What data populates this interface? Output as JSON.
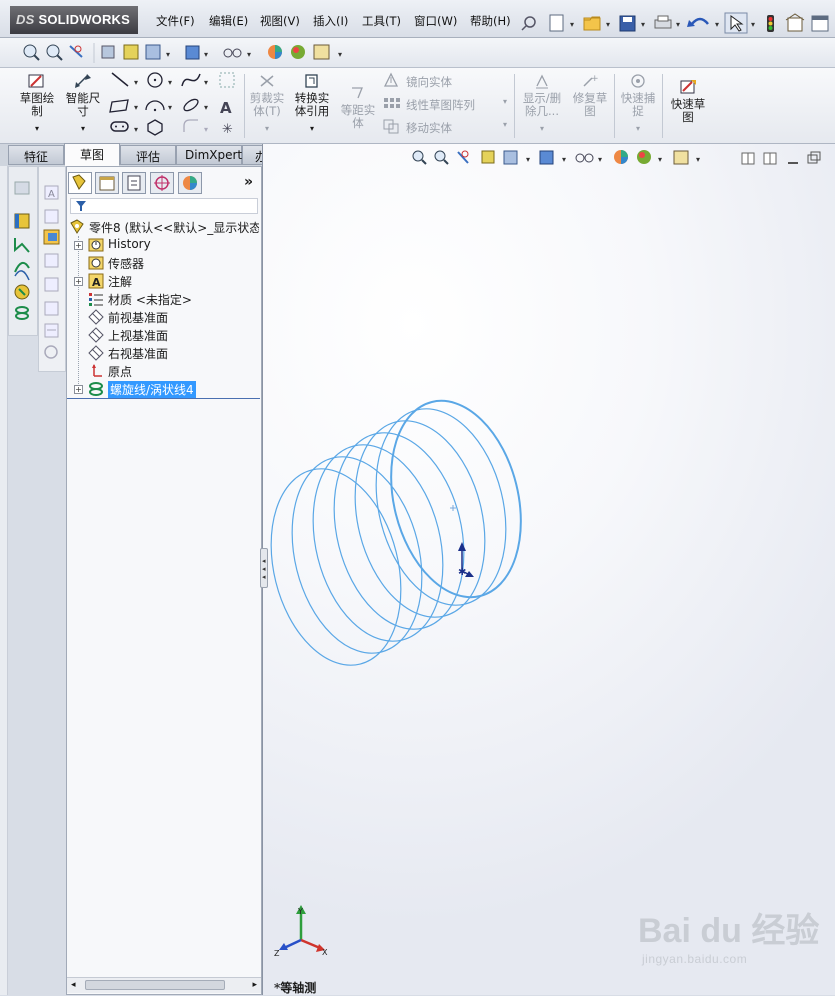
{
  "app": {
    "logo_ds": "DS",
    "logo_text": "SOLIDWORKS"
  },
  "menu": [
    "文件(F)",
    "编辑(E)",
    "视图(V)",
    "插入(I)",
    "工具(T)",
    "窗口(W)",
    "帮助(H)"
  ],
  "ribbon": {
    "sketch": "草图绘\n制",
    "smart_dim": "智能尺\n寸",
    "trim": "剪裁实\n体(T)",
    "convert": "转换实\n体引用",
    "offset": "等距实\n体",
    "mirror": "镜向实体",
    "pattern": "线性草图阵列",
    "move": "移动实体",
    "display_delete": "显示/删\n除几...",
    "repair": "修复草\n图",
    "quick_snap": "快速捕\n捉",
    "rapid_sketch": "快速草\n图"
  },
  "tabs": [
    {
      "label": "特征",
      "active": false
    },
    {
      "label": "草图",
      "active": true
    },
    {
      "label": "评估",
      "active": false
    },
    {
      "label": "DimXpert",
      "active": false
    },
    {
      "label": "办公室产品",
      "active": false
    }
  ],
  "fm_more": "»",
  "tree": {
    "root": "零件8 (默认<<默认>_显示状态",
    "items": [
      {
        "label": "History",
        "expander": true
      },
      {
        "label": "传感器",
        "expander": false
      },
      {
        "label": "注解",
        "expander": true
      },
      {
        "label": "材质 <未指定>",
        "expander": false
      },
      {
        "label": "前视基准面",
        "expander": false
      },
      {
        "label": "上视基准面",
        "expander": false
      },
      {
        "label": "右视基准面",
        "expander": false
      },
      {
        "label": "原点",
        "expander": false
      },
      {
        "label": "螺旋线/涡状线4",
        "expander": true,
        "selected": true
      }
    ]
  },
  "viewport": {
    "view_name": "*等轴测",
    "triad": {
      "x": "X",
      "y": "Y",
      "z": "Z"
    }
  },
  "watermark": {
    "big": "Bai du 经验",
    "small": "jingyan.baidu.com"
  },
  "colors": {
    "accent": "#3399ff",
    "helix": "#5aa7e6",
    "triad_x": "#d0342c",
    "triad_y": "#2e9e3c",
    "triad_z": "#2850c8"
  }
}
